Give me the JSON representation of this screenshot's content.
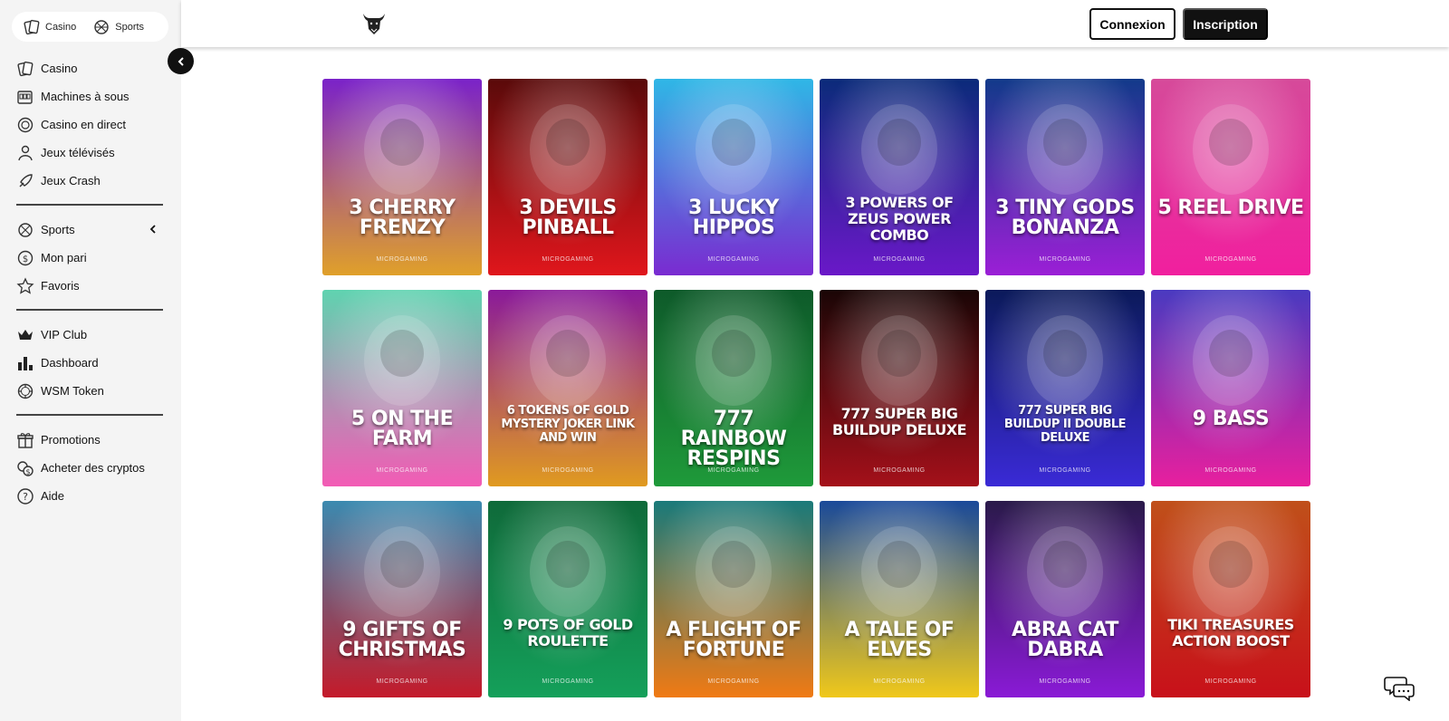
{
  "switcher": {
    "casino": "Casino",
    "sports": "Sports"
  },
  "nav_group1": [
    {
      "label": "Casino",
      "icon": "cards-icon"
    },
    {
      "label": "Machines à sous",
      "icon": "slot-machine-icon"
    },
    {
      "label": "Casino en direct",
      "icon": "live-chip-icon"
    },
    {
      "label": "Jeux télévisés",
      "icon": "tv-host-icon"
    },
    {
      "label": "Jeux Crash",
      "icon": "rocket-icon"
    }
  ],
  "nav_group2": [
    {
      "label": "Sports",
      "icon": "ball-icon"
    },
    {
      "label": "Mon pari",
      "icon": "coin-icon"
    },
    {
      "label": "Favoris",
      "icon": "star-icon"
    }
  ],
  "nav_group3": [
    {
      "label": "VIP Club",
      "icon": "crown-icon"
    },
    {
      "label": "Dashboard",
      "icon": "bar-chart-icon"
    },
    {
      "label": "WSM Token",
      "icon": "token-icon"
    }
  ],
  "nav_group4": [
    {
      "label": "Promotions",
      "icon": "gift-icon"
    },
    {
      "label": "Acheter des cryptos",
      "icon": "crypto-coins-icon"
    },
    {
      "label": "Aide",
      "icon": "help-icon"
    }
  ],
  "header": {
    "login": "Connexion",
    "signup": "Inscription"
  },
  "games": [
    {
      "title": "3 Cherry Frenzy",
      "provider": "MICROGAMING",
      "c1": "#7a22c9",
      "c2": "#e0a02a"
    },
    {
      "title": "3 Devils Pinball",
      "provider": "MICROGAMING",
      "c1": "#5a0a0a",
      "c2": "#e0161c"
    },
    {
      "title": "3 Lucky Hippos",
      "provider": "MICROGAMING",
      "c1": "#2fb7e6",
      "c2": "#7a2bd1"
    },
    {
      "title": "3 Powers of Zeus Power Combo",
      "provider": "MICROGAMING",
      "c1": "#0b2b7a",
      "c2": "#6a18c8"
    },
    {
      "title": "3 Tiny Gods Bonanza",
      "provider": "MICROGAMING",
      "c1": "#123a8a",
      "c2": "#9b1fd6"
    },
    {
      "title": "5 Reel Drive",
      "provider": "MICROGAMING",
      "c1": "#d64a9a",
      "c2": "#f11f9e"
    },
    {
      "title": "5 On The Farm",
      "provider": "MICROGAMING",
      "c1": "#5fd3b0",
      "c2": "#f35bb5"
    },
    {
      "title": "6 Tokens of Gold Mystery Joker Link and Win",
      "provider": "MICROGAMING",
      "c1": "#8a1a9a",
      "c2": "#e09a20"
    },
    {
      "title": "777 Rainbow Respins",
      "provider": "MICROGAMING",
      "c1": "#0e5a2a",
      "c2": "#1f9a3a"
    },
    {
      "title": "777 Super Big Buildup Deluxe",
      "provider": "MICROGAMING",
      "c1": "#1a0606",
      "c2": "#a4101a"
    },
    {
      "title": "777 Super Big Buildup II Double Deluxe",
      "provider": "MICROGAMING",
      "c1": "#0b1a5a",
      "c2": "#3a2ad6"
    },
    {
      "title": "9 Bass",
      "provider": "MICROGAMING",
      "c1": "#4a3ac0",
      "c2": "#e81f9e"
    },
    {
      "title": "9 Gifts of Christmas",
      "provider": "MICROGAMING",
      "c1": "#3b8ab0",
      "c2": "#c41a2a"
    },
    {
      "title": "9 Pots of Gold Roulette",
      "provider": "MICROGAMING",
      "c1": "#0f6a3a",
      "c2": "#14a05a"
    },
    {
      "title": "A Flight of Fortune",
      "provider": "MICROGAMING",
      "c1": "#1a7a7a",
      "c2": "#f07a14"
    },
    {
      "title": "A Tale of Elves",
      "provider": "MICROGAMING",
      "c1": "#1a4a9a",
      "c2": "#f0c81a"
    },
    {
      "title": "Abra Cat Dabra",
      "provider": "MICROGAMING",
      "c1": "#2a1a4a",
      "c2": "#8a1ad6"
    },
    {
      "title": "Tiki Treasures Action Boost",
      "provider": "MICROGAMING",
      "c1": "#c0501a",
      "c2": "#c8101a"
    }
  ]
}
